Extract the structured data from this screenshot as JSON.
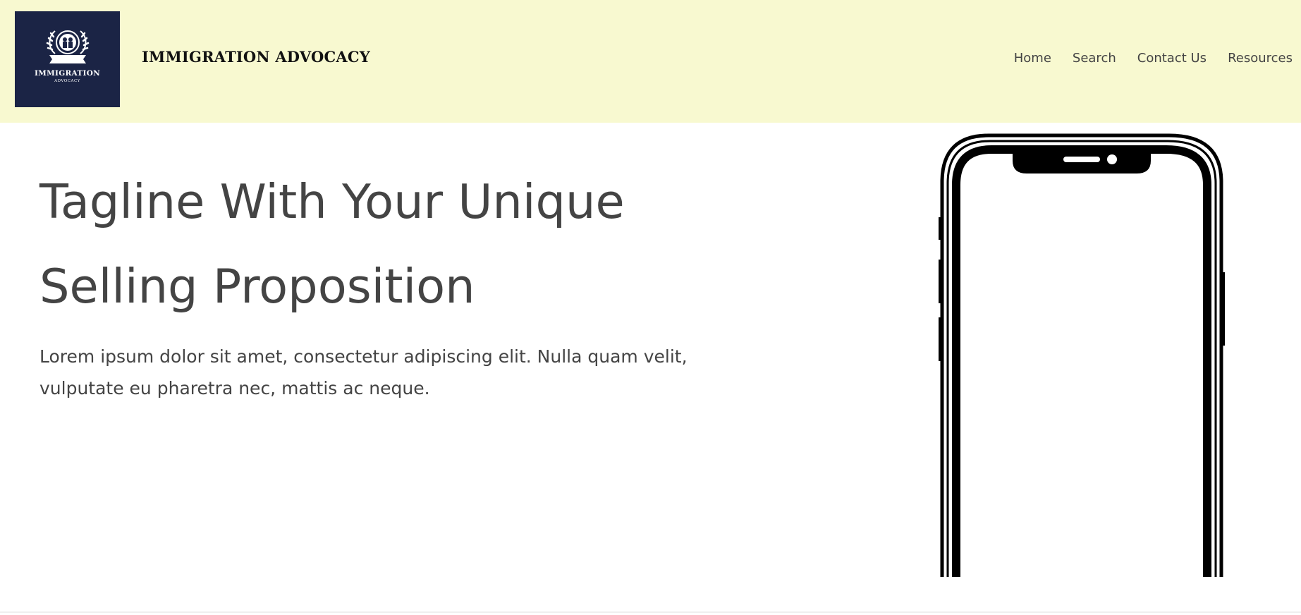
{
  "brand": {
    "logo_title": "IMMIGRATION",
    "logo_subtitle": "ADVOCACY",
    "name": "IMMIGRATION ADVOCACY",
    "logo_bg": "#1b2445"
  },
  "header": {
    "background": "#f8f9d0"
  },
  "nav": {
    "items": [
      {
        "label": "Home"
      },
      {
        "label": "Search"
      },
      {
        "label": "Contact Us"
      },
      {
        "label": "Resources"
      }
    ]
  },
  "hero": {
    "tagline_line1": "Tagline With Your Unique",
    "tagline_line2": "Selling Proposition",
    "body_line1": "Lorem ipsum dolor sit amet, consectetur adipiscing elit. Nulla quam velit,",
    "body_line2": "vulputate eu pharetra nec, mattis ac neque."
  },
  "icons": {
    "logo_emblem": "laurel-emblem-icon",
    "phone": "smartphone-outline-icon"
  }
}
